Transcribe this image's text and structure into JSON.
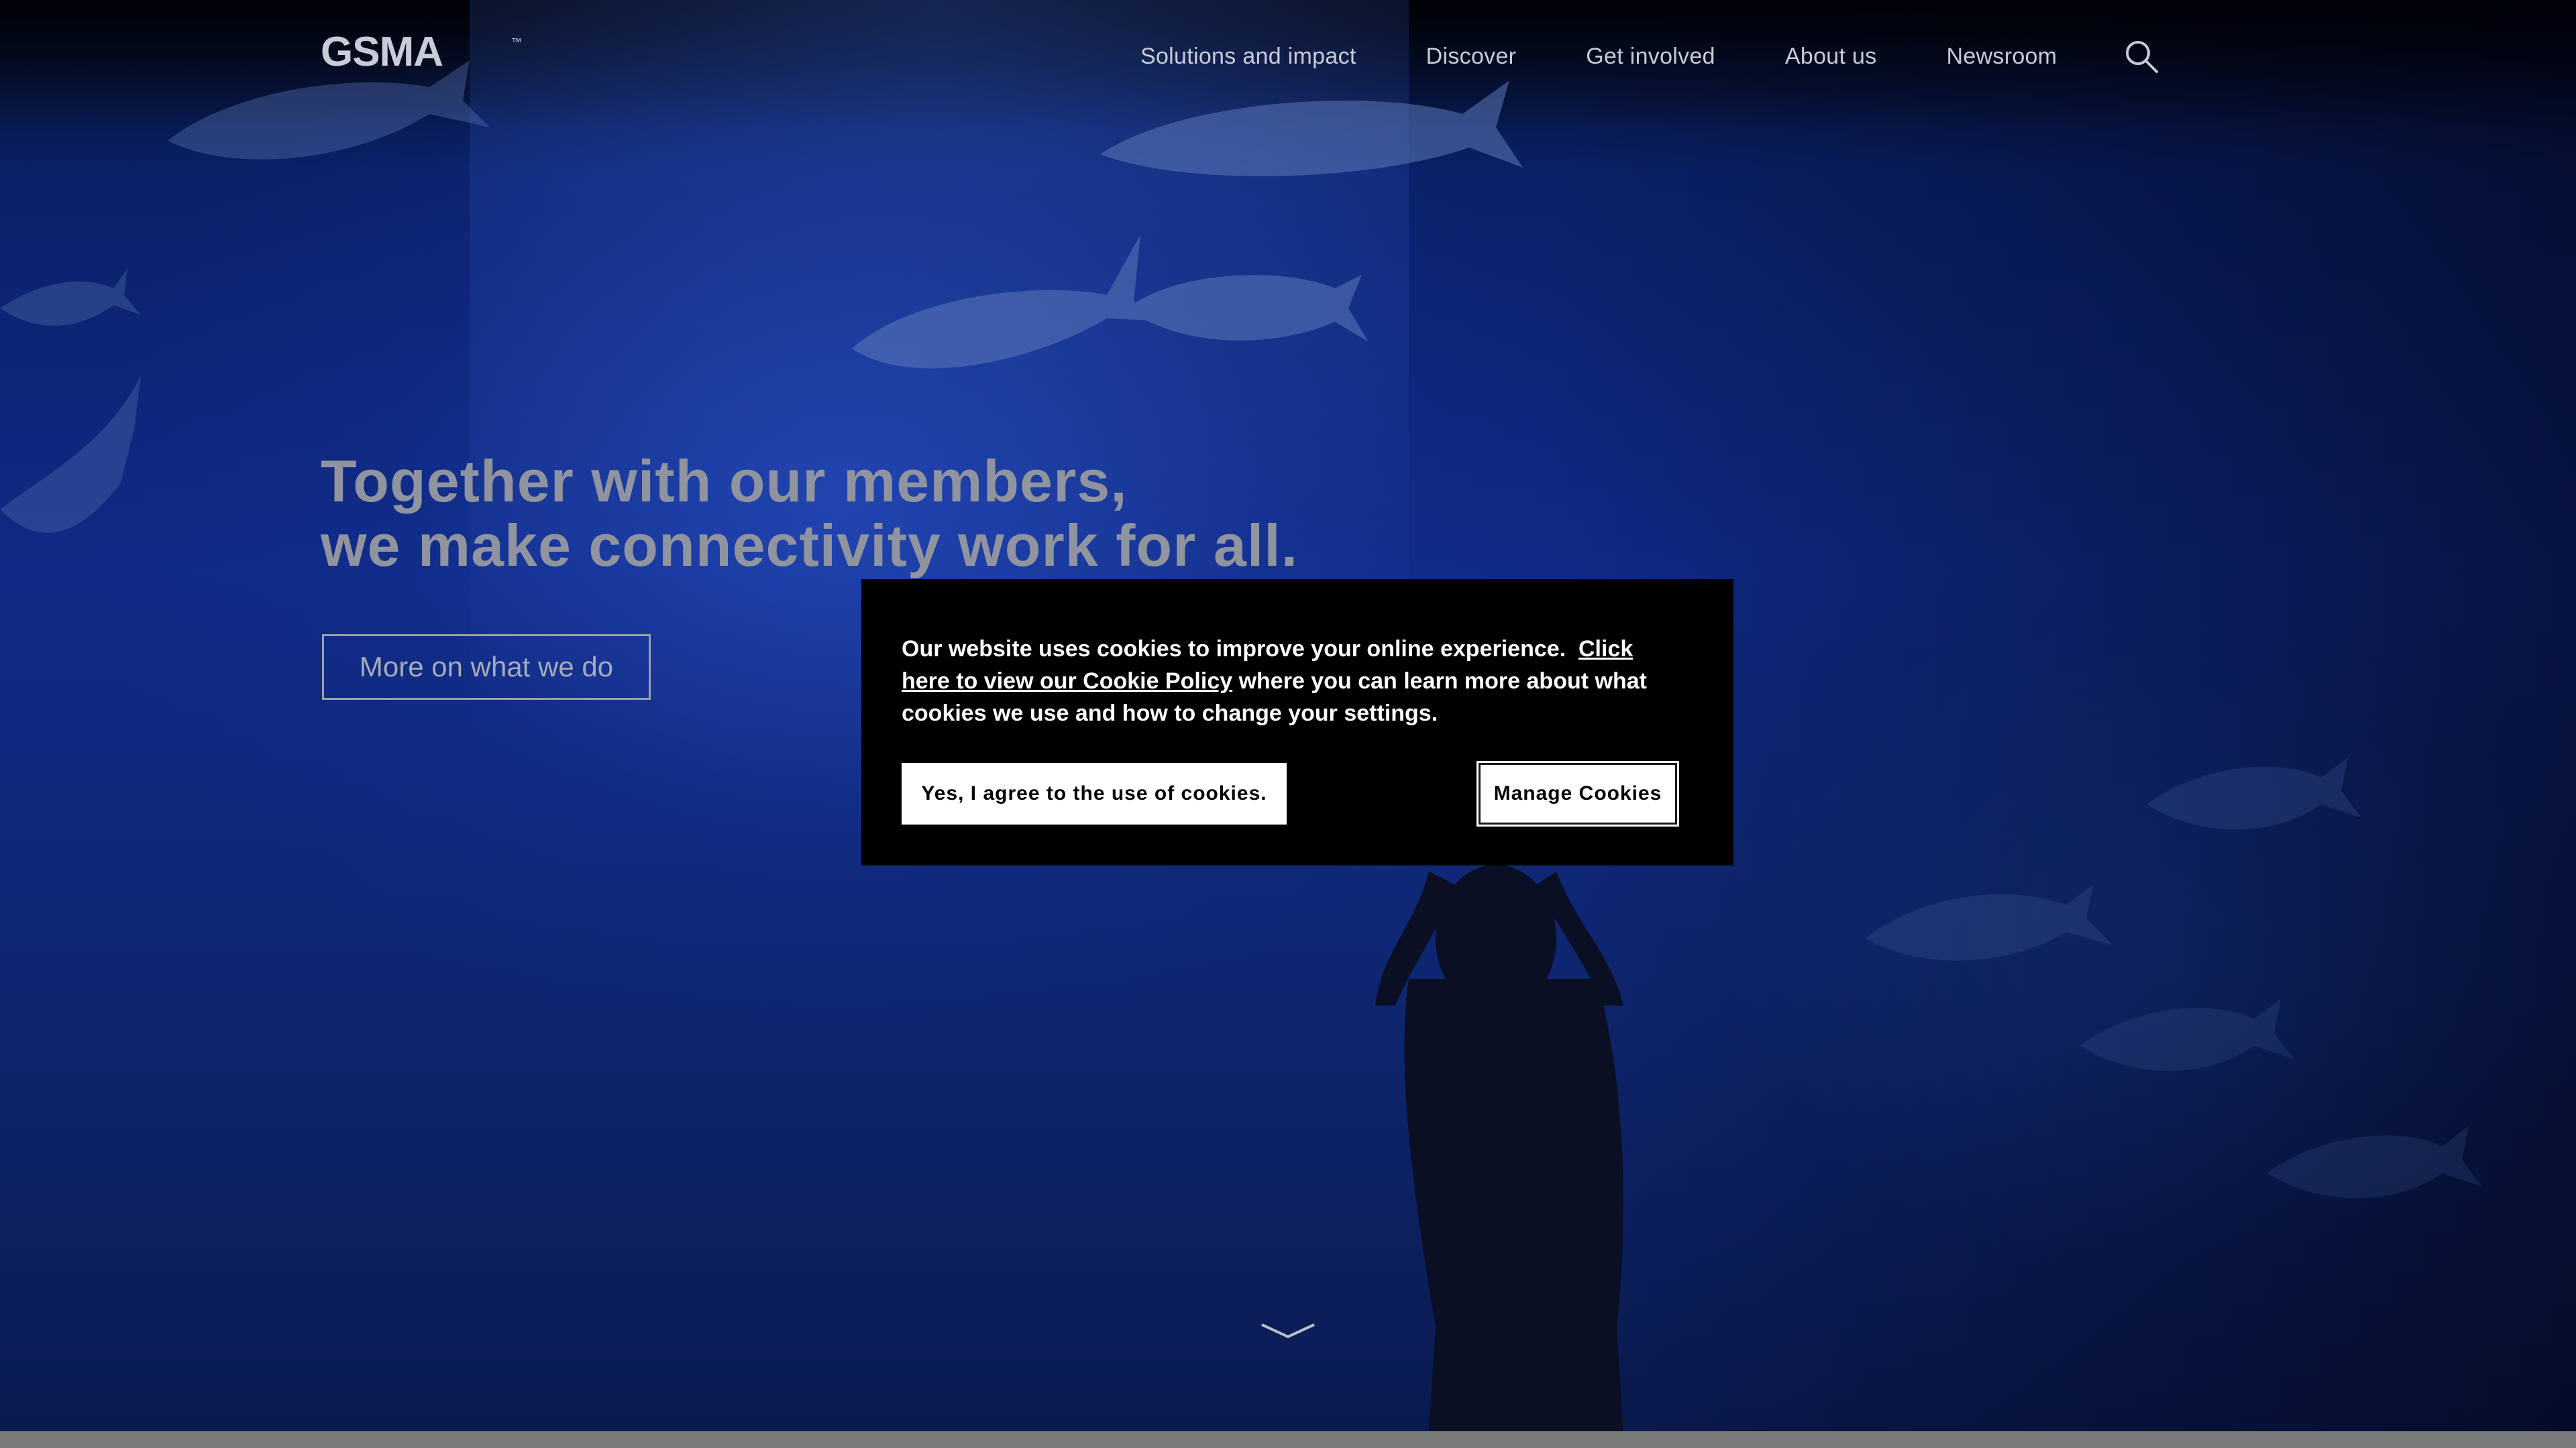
{
  "site": {
    "logo_text": "GSMA",
    "logo_mark": "™"
  },
  "nav": {
    "items": [
      {
        "label": "Solutions and impact"
      },
      {
        "label": "Discover"
      },
      {
        "label": "Get involved"
      },
      {
        "label": "About us"
      },
      {
        "label": "Newsroom"
      }
    ],
    "search_icon": "search-icon"
  },
  "hero": {
    "title_line1": "Together with our members,",
    "title_line2": "we make connectivity work for all.",
    "cta_label": "More on what we do",
    "scroll_icon": "chevron-down-icon"
  },
  "cookie_banner": {
    "text_before": "Our website uses cookies to improve your online experience.  ",
    "link_text": "Click here to view our Cookie Policy",
    "text_after": " where you can learn more about what cookies we use and how to change your settings.",
    "agree_label": "Yes, I agree to the use of cookies.",
    "manage_label": "Manage Cookies"
  },
  "colors": {
    "hero_blue": "#102a86",
    "banner_bg": "#000000",
    "nav_text": "#c9ccd6",
    "hero_text": "#8f949f"
  }
}
